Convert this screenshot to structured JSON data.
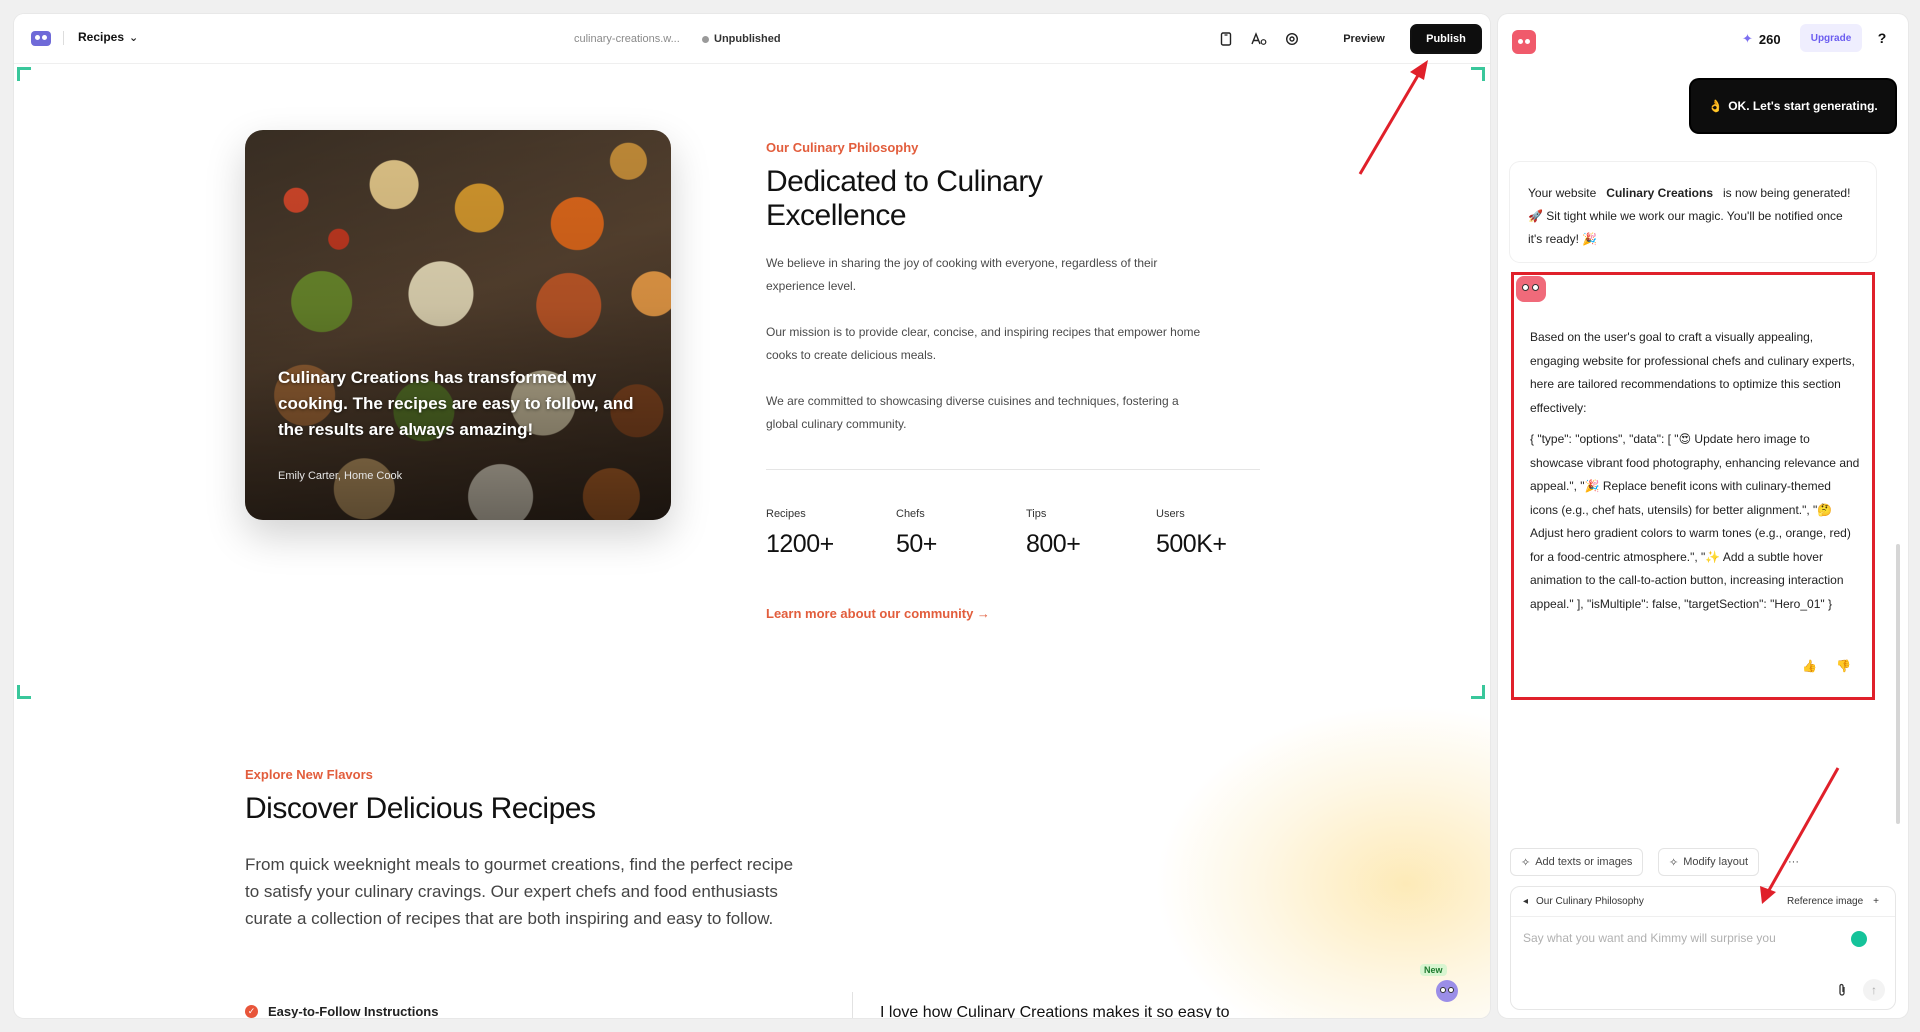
{
  "topbar": {
    "page_selector": "Recipes",
    "domain": "culinary-creations.w...",
    "status": "Unpublished",
    "preview_label": "Preview",
    "publish_label": "Publish"
  },
  "hero_section": {
    "quote": "Culinary Creations has transformed my cooking. The recipes are easy to follow, and the results are always amazing!",
    "quote_author": "Emily Carter, Home Cook",
    "eyebrow": "Our Culinary Philosophy",
    "heading_line1": "Dedicated to Culinary",
    "heading_line2": "Excellence",
    "paragraphs": [
      "We believe in sharing the joy of cooking with everyone, regardless of their experience level.",
      "Our mission is to provide clear, concise, and inspiring recipes that empower home cooks to create delicious meals.",
      "We are committed to showcasing diverse cuisines and techniques, fostering a global culinary community."
    ],
    "stats": [
      {
        "label": "Recipes",
        "value": "1200+"
      },
      {
        "label": "Chefs",
        "value": "50+"
      },
      {
        "label": "Tips",
        "value": "800+"
      },
      {
        "label": "Users",
        "value": "500K+"
      }
    ],
    "learn_more": "Learn more about our community →"
  },
  "recipes_section": {
    "eyebrow": "Explore New Flavors",
    "heading": "Discover Delicious Recipes",
    "body": "From quick weeknight meals to gourmet creations, find the perfect recipe to satisfy your culinary cravings. Our expert chefs and food enthusiasts curate a collection of recipes that are both inspiring and easy to follow.",
    "feature_1": "Easy-to-Follow Instructions",
    "testimonial_snippet": "I love how Culinary Creations makes it so easy to",
    "new_badge": "New"
  },
  "chat": {
    "credits": "260",
    "upgrade_label": "Upgrade",
    "help_label": "?",
    "user_message": "OK. Let's start generating.",
    "user_message_emoji": "👌",
    "bot_msg1_prefix": "Your website",
    "bot_msg1_site": "Culinary Creations",
    "bot_msg1_suffix": "is now being generated! 🚀 Sit tight while we work our magic. You'll be notified once it's ready! 🎉",
    "bot_msg2_intro": "Based on the user's goal to craft a visually appealing, engaging website for professional chefs and culinary experts, here are tailored recommendations to optimize this section effectively:",
    "bot_msg2_json": "{ \"type\": \"options\", \"data\": [ \"😍 Update hero image to showcase vibrant food photography, enhancing relevance and appeal.\", \"🎉 Replace benefit icons with culinary-themed icons (e.g., chef hats, utensils) for better alignment.\", \"🤔 Adjust hero gradient colors to warm tones (e.g., orange, red) for a food-centric atmosphere.\", \"✨ Add a subtle hover animation to the call-to-action button, increasing interaction appeal.\" ], \"isMultiple\": false, \"targetSection\": \"Hero_01\" }",
    "chip_add": "Add texts or images",
    "chip_modify": "Modify layout",
    "chip_more": "···",
    "context_section": "Our Culinary Philosophy",
    "reference_image": "Reference image",
    "input_placeholder": "Say what you want and Kimmy will surprise you"
  },
  "colors": {
    "accent": "#e25d3c",
    "publish_bg": "#0e0e0e",
    "upgrade_text": "#6b5df0",
    "annotation_red": "#e0202a",
    "selection_green": "#39c79b"
  },
  "icons": [
    "logo-icon",
    "chevron-down-icon",
    "device-icon",
    "font-icon",
    "settings-icon",
    "sparkle-icon",
    "thumbs-up-icon",
    "thumbs-down-icon",
    "attach-icon",
    "send-icon",
    "check-icon"
  ]
}
